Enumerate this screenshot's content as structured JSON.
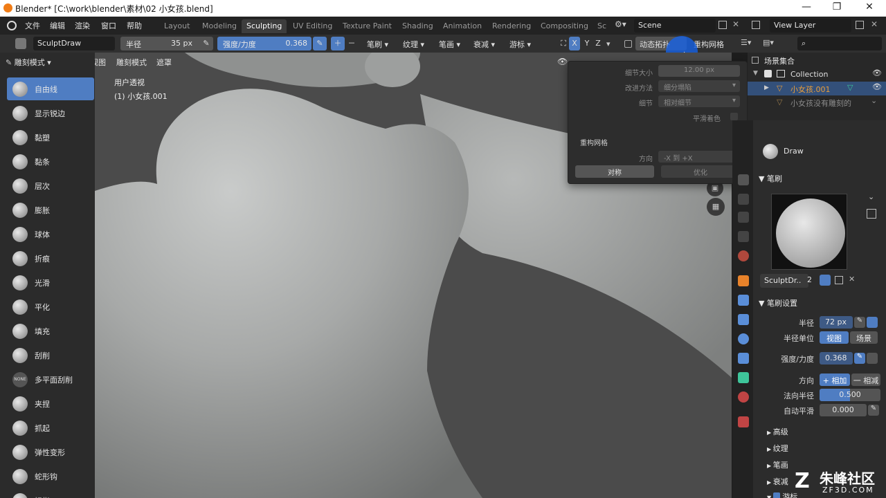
{
  "window": {
    "title": "Blender* [C:\\work\\blender\\素材\\02 小女孩.blend]",
    "controls": [
      "—",
      "❐",
      "✕"
    ]
  },
  "menubar": {
    "menus": [
      "文件",
      "编辑",
      "渲染",
      "窗口",
      "帮助"
    ],
    "workspaces": [
      "Layout",
      "Modeling",
      "Sculpting",
      "UV Editing",
      "Texture Paint",
      "Shading",
      "Animation",
      "Rendering",
      "Compositing",
      "Sc"
    ],
    "active_workspace": "Sculpting",
    "scene": "Scene",
    "view_layer": "View Layer"
  },
  "tool_header": {
    "brush_name": "SculptDraw",
    "radius_label": "半径",
    "radius_value": "35 px",
    "strength_label": "强度/力度",
    "strength_value": "0.368",
    "dropdowns": [
      "笔刷",
      "纹理",
      "笔画",
      "衰减",
      "游标"
    ],
    "axes": [
      "X",
      "Y",
      "Z"
    ],
    "dyntopo_label": "动态拓扑",
    "remesh_label": "重构网格"
  },
  "viewport_header": {
    "mode": "雕刻模式",
    "menus": [
      "视图",
      "雕刻模式",
      "遮罩"
    ],
    "view_name": "用户透视",
    "object_name": "(1) 小女孩.001"
  },
  "tools": [
    {
      "label": "自由线",
      "active": true
    },
    {
      "label": "显示锐边"
    },
    {
      "label": "黏塑"
    },
    {
      "label": "黏条"
    },
    {
      "label": "层次"
    },
    {
      "label": "膨胀"
    },
    {
      "label": "球体"
    },
    {
      "label": "折痕"
    },
    {
      "label": "光滑"
    },
    {
      "label": "平化"
    },
    {
      "label": "填充"
    },
    {
      "label": "刮削"
    },
    {
      "label": "多平面刮削",
      "badge": "NONE"
    },
    {
      "label": "夹捏"
    },
    {
      "label": "抓起"
    },
    {
      "label": "弹性变形"
    },
    {
      "label": "蛇形钩"
    },
    {
      "label": "拇指"
    }
  ],
  "popover": {
    "detail_size_label": "细节大小",
    "detail_size_value": "12.00 px",
    "refine_method_label": "改进方法",
    "refine_method_value": "细分塌陷",
    "detailing_label": "细节",
    "detailing_value": "相对细节",
    "smooth_shading_label": "平滑着色",
    "remesh_title": "重构网格",
    "direction_label": "方向",
    "direction_value": "-X 到 +X",
    "symmetrize_button": "对称",
    "optimize_button": "优化"
  },
  "outliner": {
    "root": "场景集合",
    "collection": "Collection",
    "items": [
      "小女孩.001",
      "小女孩没有雕刻的"
    ]
  },
  "properties": {
    "brush_title": "Draw",
    "brush_section": "笔刷",
    "brush_preview_name": "SculptDr..",
    "brush_users": "2",
    "brush_settings_section": "笔刷设置",
    "radius_label": "半径",
    "radius_value": "72 px",
    "radius_unit_label": "半径单位",
    "radius_unit_options": [
      "视图",
      "场景"
    ],
    "strength_label": "强度/力度",
    "strength_value": "0.368",
    "direction_label": "方向",
    "direction_options": [
      "+ 相加",
      "一 相减"
    ],
    "normal_radius_label": "法向半径",
    "normal_radius_value": "0.500",
    "auto_smooth_label": "自动平滑",
    "auto_smooth_value": "0.000",
    "subsections": [
      "高级",
      "纹理",
      "笔画",
      "衰减",
      "游标"
    ]
  },
  "watermark": {
    "text": "朱峰社区",
    "url": "ZF3D.COM"
  },
  "colors": {
    "accent": "#4f7dc2",
    "header": "#303030",
    "panel": "#2b2b2b",
    "viewport_bg": "#4a4a4a",
    "object_orange": "#e89d3b"
  }
}
